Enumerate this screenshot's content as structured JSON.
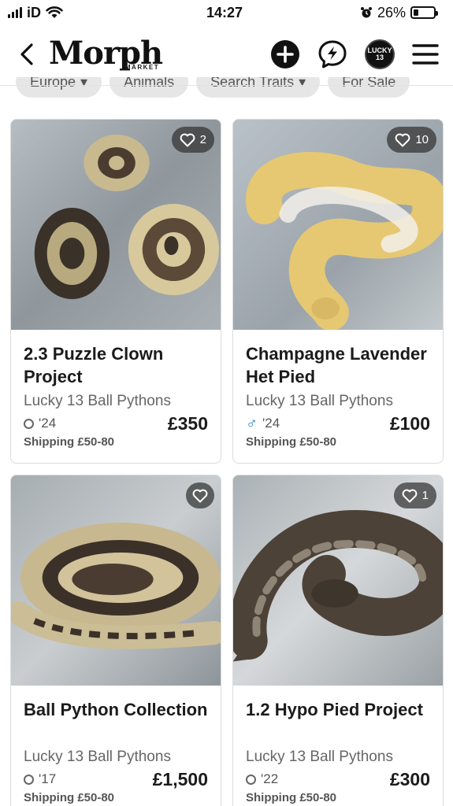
{
  "status_bar": {
    "carrier": "iD",
    "time": "14:27",
    "battery_percent": "26%",
    "battery_level": 0.26
  },
  "header": {
    "logo_text": "Morph",
    "logo_sub": "MARKET",
    "avatar_text": "LUCKY 13"
  },
  "filters": [
    "Europe",
    "Animals",
    "Search Traits",
    "For Sale"
  ],
  "listings": [
    {
      "title": "2.3 Puzzle Clown Project",
      "seller": "Lucky 13 Ball Pythons",
      "sex": "unknown",
      "year": "'24",
      "price": "£350",
      "shipping": "Shipping £50-80",
      "favorites": "2"
    },
    {
      "title": "Champagne Lavender Het Pied",
      "seller": "Lucky 13 Ball Pythons",
      "sex": "male",
      "year": "'24",
      "price": "£100",
      "shipping": "Shipping £50-80",
      "favorites": "10"
    },
    {
      "title": "Ball Python Collection",
      "seller": "Lucky 13 Ball Pythons",
      "sex": "unknown",
      "year": "'17",
      "price": "£1,500",
      "shipping": "Shipping £50-80",
      "favorites": ""
    },
    {
      "title": "1.2 Hypo Pied Project",
      "seller": "Lucky 13 Ball Pythons",
      "sex": "unknown",
      "year": "'22",
      "price": "£300",
      "shipping": "Shipping £50-80",
      "favorites": "1"
    }
  ],
  "colors": {
    "accent_male": "#1f7fc9",
    "card_border": "#dcdcdc",
    "chip_bg": "#e6e6e6"
  }
}
